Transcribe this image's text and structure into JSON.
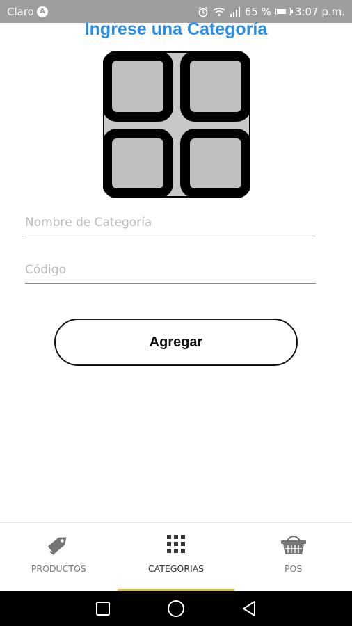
{
  "status_bar": {
    "carrier": "Claro",
    "carrier_badge": "A",
    "battery_text": "65 %",
    "battery_level": 0.65,
    "time": "3:07 p.m.",
    "icons": [
      "alarm-icon",
      "wifi-icon",
      "signal-icon",
      "battery-icon"
    ]
  },
  "page": {
    "title": "Ingrese una Categoría"
  },
  "form": {
    "name_placeholder": "Nombre de Categoría",
    "name_value": "",
    "code_placeholder": "Código",
    "code_value": "",
    "submit_label": "Agregar"
  },
  "bottom_nav": {
    "items": [
      {
        "label": "PRODUCTOS",
        "icon": "tag-icon",
        "active": false
      },
      {
        "label": "CATEGORIAS",
        "icon": "grid-icon",
        "active": true
      },
      {
        "label": "POS",
        "icon": "basket-icon",
        "active": false
      }
    ],
    "indicator_color": "#f2c200"
  },
  "system_nav": {
    "buttons": [
      "recents-button",
      "home-button",
      "back-button"
    ]
  },
  "colors": {
    "title": "#2a8ee8",
    "status_bar": "#9e9e9e"
  }
}
